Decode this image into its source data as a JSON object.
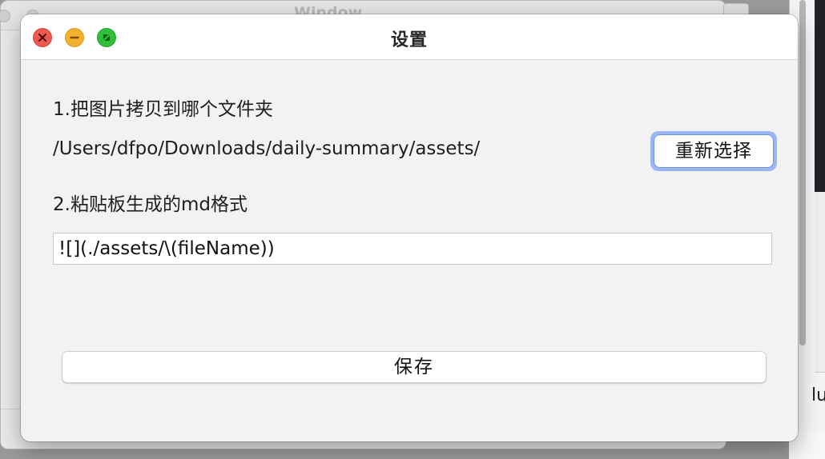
{
  "dialog": {
    "title": "设置",
    "section1_label": "1.把图片拷贝到哪个文件夹",
    "folder_path": "/Users/dfpo/Downloads/daily-summary/assets/",
    "reselect_button": "重新选择",
    "section2_label": "2.粘贴板生成的md格式",
    "format_value": "![](./assets/\\(fileName))",
    "save_button": "保存"
  },
  "background": {
    "window_title": "Window",
    "right_edge_text": "lu"
  },
  "colors": {
    "close": "#ee5a52",
    "minimize": "#f2b22f",
    "zoom": "#2fbf3a",
    "focus_ring": "#9ab7f3"
  },
  "icons": {
    "close": "close-icon",
    "minimize": "minimize-icon",
    "zoom": "zoom-icon"
  }
}
